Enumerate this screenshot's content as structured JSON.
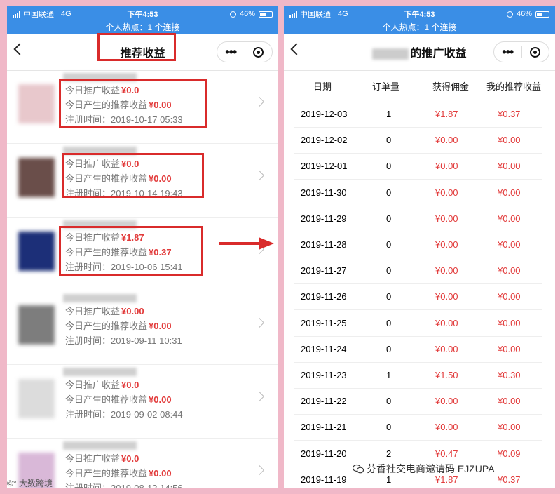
{
  "left_phone": {
    "status": {
      "carrier": "中国联通",
      "network": "4G",
      "time": "下午4:53",
      "battery": "46%"
    },
    "hotspot": "个人热点：1 个连接",
    "title": "推荐收益",
    "items": [
      {
        "line1_label": "今日推广收益",
        "line1_value": "¥0.0",
        "line2_label": "今日产生的推荐收益",
        "line2_value": "¥0.00",
        "reg": "注册时间：2019-10-17 05:33",
        "avatar_color": "#e8c8cc"
      },
      {
        "line1_label": "今日推广收益",
        "line1_value": "¥0.0",
        "line2_label": "今日产生的推荐收益",
        "line2_value": "¥0.00",
        "reg": "注册时间：2019-10-14 19:43",
        "avatar_color": "#6a4e4a"
      },
      {
        "line1_label": "今日推广收益",
        "line1_value": "¥1.87",
        "line2_label": "今日产生的推荐收益",
        "line2_value": "¥0.37",
        "reg": "注册时间：2019-10-06 15:41",
        "avatar_color": "#1c2f78"
      },
      {
        "line1_label": "今日推广收益",
        "line1_value": "¥0.00",
        "line2_label": "今日产生的推荐收益",
        "line2_value": "¥0.00",
        "reg": "注册时间：2019-09-11 10:31",
        "avatar_color": "#7d7d7d"
      },
      {
        "line1_label": "今日推广收益",
        "line1_value": "¥0.0",
        "line2_label": "今日产生的推荐收益",
        "line2_value": "¥0.00",
        "reg": "注册时间：2019-09-02 08:44",
        "avatar_color": "#dcdcdc"
      },
      {
        "line1_label": "今日推广收益",
        "line1_value": "¥0.0",
        "line2_label": "今日产生的推荐收益",
        "line2_value": "¥0.00",
        "reg": "注册时间：2019-08-13 14:56",
        "avatar_color": "#d9b8d8"
      }
    ]
  },
  "right_phone": {
    "status": {
      "carrier": "中国联通",
      "network": "4G",
      "time": "下午4:53",
      "battery": "46%"
    },
    "hotspot": "个人热点：1 个连接",
    "title": "的推广收益",
    "headers": [
      "日期",
      "订单量",
      "获得佣金",
      "我的推荐收益"
    ],
    "rows": [
      {
        "date": "2019-12-03",
        "orders": "1",
        "commission": "¥1.87",
        "income": "¥0.37"
      },
      {
        "date": "2019-12-02",
        "orders": "0",
        "commission": "¥0.00",
        "income": "¥0.00"
      },
      {
        "date": "2019-12-01",
        "orders": "0",
        "commission": "¥0.00",
        "income": "¥0.00"
      },
      {
        "date": "2019-11-30",
        "orders": "0",
        "commission": "¥0.00",
        "income": "¥0.00"
      },
      {
        "date": "2019-11-29",
        "orders": "0",
        "commission": "¥0.00",
        "income": "¥0.00"
      },
      {
        "date": "2019-11-28",
        "orders": "0",
        "commission": "¥0.00",
        "income": "¥0.00"
      },
      {
        "date": "2019-11-27",
        "orders": "0",
        "commission": "¥0.00",
        "income": "¥0.00"
      },
      {
        "date": "2019-11-26",
        "orders": "0",
        "commission": "¥0.00",
        "income": "¥0.00"
      },
      {
        "date": "2019-11-25",
        "orders": "0",
        "commission": "¥0.00",
        "income": "¥0.00"
      },
      {
        "date": "2019-11-24",
        "orders": "0",
        "commission": "¥0.00",
        "income": "¥0.00"
      },
      {
        "date": "2019-11-23",
        "orders": "1",
        "commission": "¥1.50",
        "income": "¥0.30"
      },
      {
        "date": "2019-11-22",
        "orders": "0",
        "commission": "¥0.00",
        "income": "¥0.00"
      },
      {
        "date": "2019-11-21",
        "orders": "0",
        "commission": "¥0.00",
        "income": "¥0.00"
      },
      {
        "date": "2019-11-20",
        "orders": "2",
        "commission": "¥0.47",
        "income": "¥0.09"
      },
      {
        "date": "2019-11-19",
        "orders": "1",
        "commission": "¥1.87",
        "income": "¥0.37"
      }
    ]
  },
  "watermark_right": "芬香社交电商邀请码 EJZUPA",
  "watermark_left": "大数跨境",
  "colors": {
    "status_bar": "#3a8ee6",
    "amount_red": "#e23b3b",
    "highlight_box": "#d92b2b",
    "background": "#f0b8c8"
  }
}
